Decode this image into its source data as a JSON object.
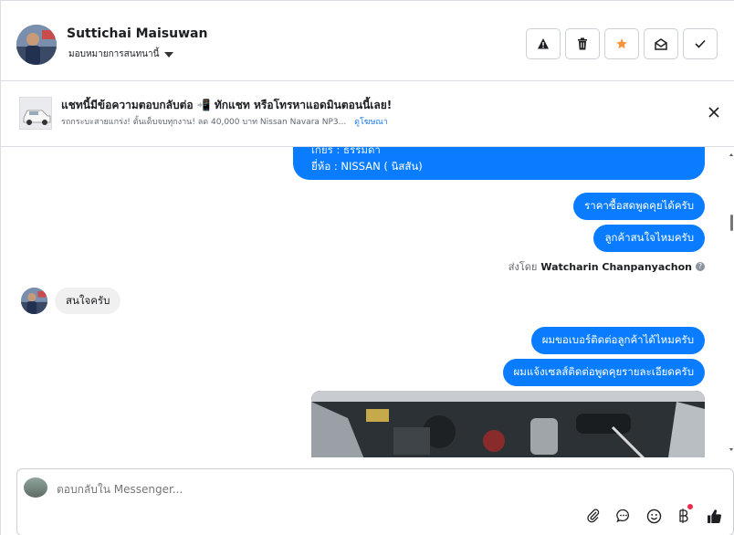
{
  "header": {
    "contact_name": "Suttichai Maisuwan",
    "assign_label": "มอบหมายการสนทนานี้",
    "buttons": [
      {
        "name": "report-spam-button",
        "icon": "warning-icon"
      },
      {
        "name": "delete-button",
        "icon": "trash-icon"
      },
      {
        "name": "star-button",
        "icon": "star-icon"
      },
      {
        "name": "mark-unread-button",
        "icon": "envelope-open-icon"
      },
      {
        "name": "mark-done-button",
        "icon": "check-icon"
      }
    ]
  },
  "ad_banner": {
    "title": "แชทนี้มีข้อความตอบกลับต่อ 📲 ทักแชท หรือโทรหาแอดมินตอนนี้เลย!",
    "subtitle": "รถกระบะสายแกร่ง! ตั้นเด็บจบทุกงาน! ลด 40,000 บาท Nissan Navara NP3...",
    "link": "ดูโฆษณา"
  },
  "messages": {
    "top_line1": "เกียร์ : ธรรมดา",
    "top_line2": "ยี่ห้อ : NISSAN ( นิสสัน)",
    "out1": "ราคาซื้อสดพูดคุยได้ครับ",
    "out2": "ลูกค้าสนใจไหมครับ",
    "sent_by_prefix": "ส่งโดย",
    "sent_by_name": "Watcharin Chanpanyachon",
    "in1": "สนใจครับ",
    "out3": "ผมขอเบอร์ติดต่อลูกค้าได้ไหมครับ",
    "out4": "ผมแจ้งเซลส์ติดต่อพูดคุยรายละเอียดครับ"
  },
  "composer": {
    "placeholder": "ตอบกลับใน Messenger..."
  },
  "colors": {
    "accent": "#0a7cff",
    "star": "#f7923b",
    "unread_dot": "#f02849"
  }
}
